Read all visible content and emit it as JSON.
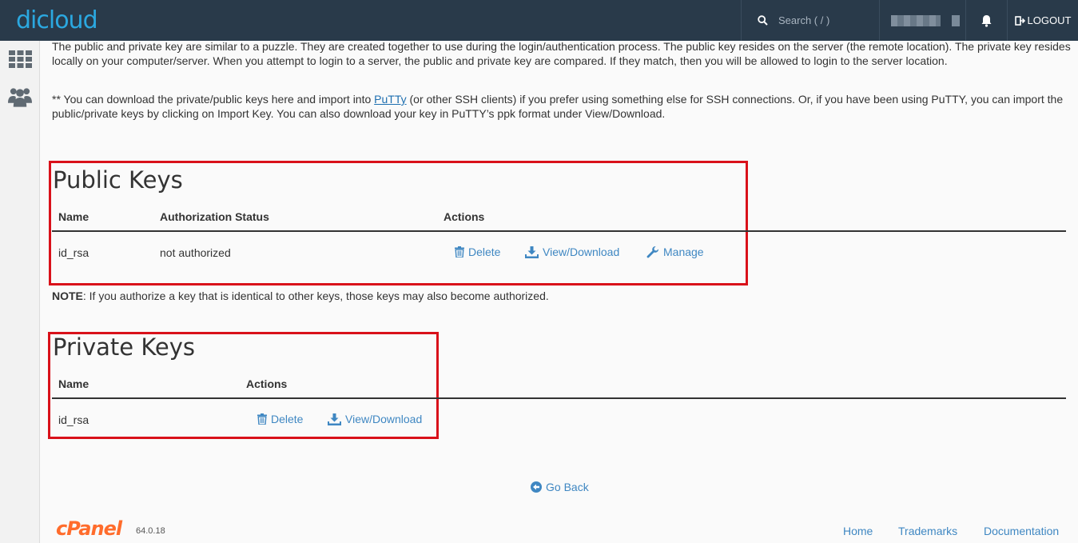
{
  "topbar": {
    "logo_text": "dicloud",
    "search_placeholder": "Search ( / )",
    "logout_label": "LOGOUT"
  },
  "intro": {
    "paragraph1": "The public and private key are similar to a puzzle. They are created together to use during the login/authentication process. The public key resides on the server (the remote location). The private key resides locally on your computer/server. When you attempt to login to a server, the public and private key are compared. If they match, then you will be allowed to login to the server location.",
    "p2_before": "** You can download the private/public keys here and import into ",
    "p2_link": "PuTTy",
    "p2_after": " (or other SSH clients) if you prefer using something else for SSH connections. Or, if you have been using PuTTY, you can import the public/private keys by clicking on Import Key. You can also download your key in PuTTY’s ppk format under View/Download."
  },
  "public_keys": {
    "title": "Public Keys",
    "headers": {
      "name": "Name",
      "status": "Authorization Status",
      "actions": "Actions"
    },
    "rows": [
      {
        "name": "id_rsa",
        "status": "not authorized",
        "delete": "Delete",
        "view": "View/Download",
        "manage": "Manage"
      }
    ]
  },
  "note": {
    "label": "NOTE",
    "text": ": If you authorize a key that is identical to other keys, those keys may also become authorized."
  },
  "private_keys": {
    "title": "Private Keys",
    "headers": {
      "name": "Name",
      "actions": "Actions"
    },
    "rows": [
      {
        "name": "id_rsa",
        "delete": "Delete",
        "view": "View/Download"
      }
    ]
  },
  "go_back": "Go Back",
  "footer": {
    "brand": "cPanel",
    "version": "64.0.18",
    "links": [
      "Home",
      "Trademarks",
      "Documentation"
    ]
  },
  "colors": {
    "topbar": "#293a4a",
    "link": "#3f87c2",
    "highlight": "#d9111a",
    "cpanel_orange": "#ff6c2c"
  }
}
